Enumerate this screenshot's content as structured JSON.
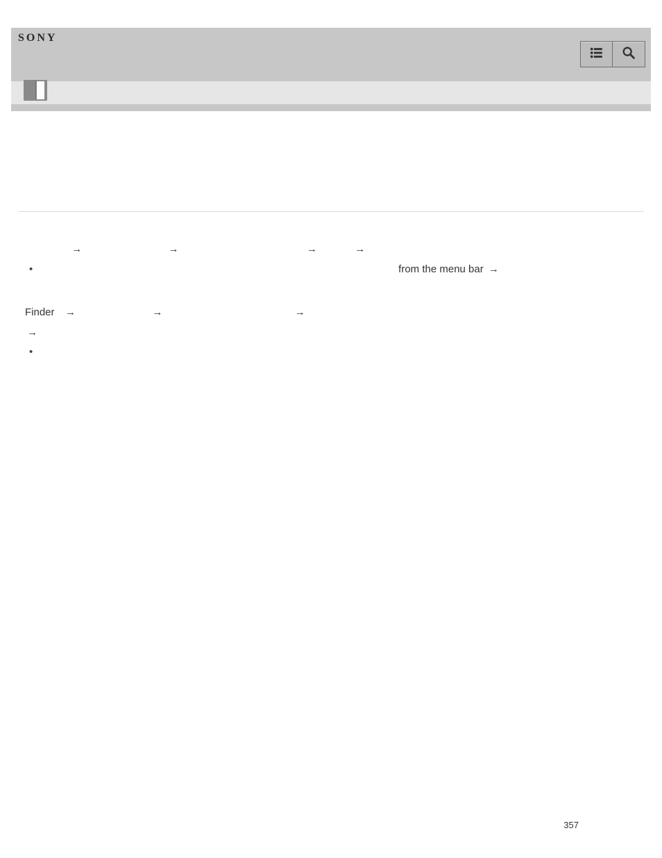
{
  "header": {
    "brand": "SONY",
    "menu_icon": "list-icon",
    "search_icon": "search-icon",
    "doc_icon": "page-icon"
  },
  "body": {
    "arrow": "→",
    "line1_tail": "from the menu bar",
    "finder_label": "Finder"
  },
  "footer": {
    "page_number": "357"
  }
}
